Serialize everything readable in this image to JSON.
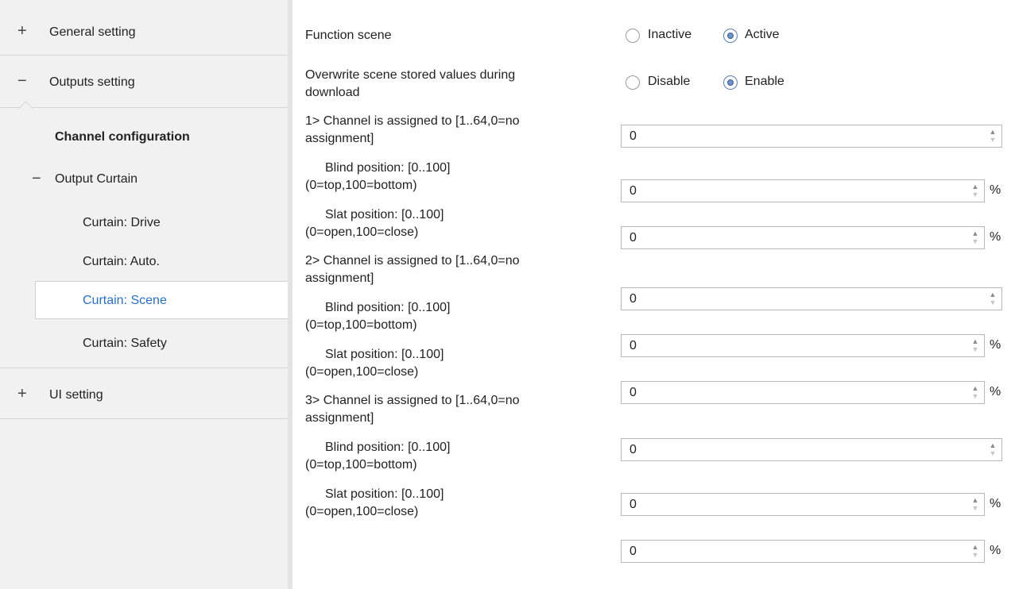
{
  "sidebar": {
    "groups": [
      {
        "sign": "+",
        "label": "General setting"
      },
      {
        "sign": "−",
        "label": "Outputs setting"
      },
      {
        "sign": "+",
        "label": "UI setting"
      }
    ],
    "channel_config": "Channel configuration",
    "output_curtain": {
      "sign": "−",
      "label": "Output Curtain"
    },
    "items": [
      "Curtain: Drive",
      "Curtain: Auto.",
      "Curtain: Scene",
      "Curtain: Safety"
    ],
    "selected_item": "Curtain: Scene",
    "selected_color": "#2a6fc0"
  },
  "params": {
    "function_scene": {
      "label": "Function scene",
      "options": [
        "Inactive",
        "Active"
      ],
      "selected": "Active"
    },
    "overwrite": {
      "label_line1": "Overwrite scene stored values during",
      "label_line2": "download",
      "options": [
        "Disable",
        "Enable"
      ],
      "selected": "Enable"
    },
    "rows": [
      {
        "line1": "1> Channel is assigned to [1..64,0=no",
        "line2": "assignment]",
        "value": "0",
        "unit": ""
      },
      {
        "line1": "Blind position: [0..100]",
        "line2": "(0=top,100=bottom)",
        "value": "0",
        "unit": "%"
      },
      {
        "line1": "Slat position: [0..100]",
        "line2": "(0=open,100=close)",
        "value": "0",
        "unit": "%"
      },
      {
        "line1": "2> Channel is assigned to [1..64,0=no",
        "line2": "assignment]",
        "value": "0",
        "unit": ""
      },
      {
        "line1": "Blind position: [0..100]",
        "line2": "(0=top,100=bottom)",
        "value": "0",
        "unit": "%"
      },
      {
        "line1": "Slat position: [0..100]",
        "line2": "(0=open,100=close)",
        "value": "0",
        "unit": "%"
      },
      {
        "line1": "3> Channel is assigned to [1..64,0=no",
        "line2": "assignment]",
        "value": "0",
        "unit": ""
      },
      {
        "line1": "Blind position: [0..100]",
        "line2": "(0=top,100=bottom)",
        "value": "0",
        "unit": "%"
      },
      {
        "line1": "Slat position: [0..100]",
        "line2": "(0=open,100=close)",
        "value": "0",
        "unit": "%"
      }
    ]
  },
  "icons": {
    "spin_up": "▲",
    "spin_down": "▼"
  }
}
